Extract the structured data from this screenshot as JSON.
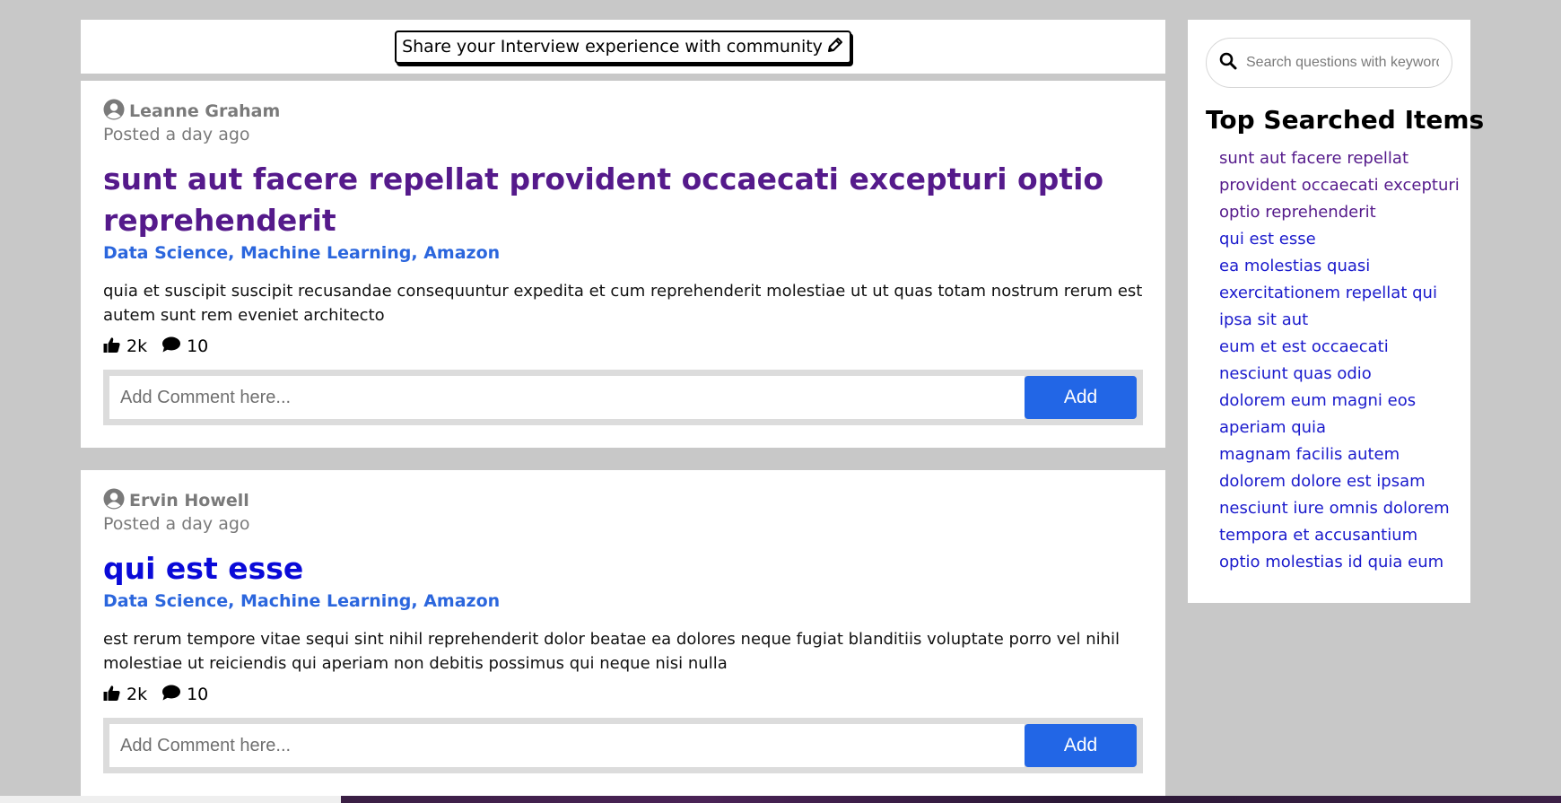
{
  "share": {
    "label": "Share your Interview experience with community",
    "icon": "pencil-icon"
  },
  "posts": [
    {
      "author": "Leanne Graham",
      "posted": "Posted a day ago",
      "title": "sunt aut facere repellat provident occaecati excepturi optio reprehenderit",
      "title_visited": true,
      "tags": "Data Science, Machine Learning, Amazon",
      "body": "quia et suscipit suscipit recusandae consequuntur expedita et cum reprehenderit molestiae ut ut quas totam nostrum rerum est autem sunt rem eveniet architecto",
      "likes": "2k",
      "comments": "10",
      "comment_placeholder": "Add Comment here...",
      "add_label": "Add"
    },
    {
      "author": "Ervin Howell",
      "posted": "Posted a day ago",
      "title": "qui est esse",
      "title_visited": false,
      "tags": "Data Science, Machine Learning, Amazon",
      "body": "est rerum tempore vitae sequi sint nihil reprehenderit dolor beatae ea dolores neque fugiat blanditiis voluptate porro vel nihil molestiae ut reiciendis qui aperiam non debitis possimus qui neque nisi nulla",
      "likes": "2k",
      "comments": "10",
      "comment_placeholder": "Add Comment here...",
      "add_label": "Add"
    }
  ],
  "sidebar": {
    "search_placeholder": "Search questions with keywords",
    "top_title": "Top Searched Items",
    "items": [
      {
        "label": "sunt aut facere repellat",
        "visited": true
      },
      {
        "label": "provident occaecati excepturi",
        "visited": true
      },
      {
        "label": "optio reprehenderit",
        "visited": true
      },
      {
        "label": "qui est esse",
        "visited": false
      },
      {
        "label": "ea molestias quasi",
        "visited": false
      },
      {
        "label": "exercitationem repellat qui",
        "visited": false
      },
      {
        "label": "ipsa sit aut",
        "visited": false
      },
      {
        "label": "eum et est occaecati",
        "visited": false
      },
      {
        "label": "nesciunt quas odio",
        "visited": false
      },
      {
        "label": "dolorem eum magni eos",
        "visited": false
      },
      {
        "label": "aperiam quia",
        "visited": false
      },
      {
        "label": "magnam facilis autem",
        "visited": false
      },
      {
        "label": "dolorem dolore est ipsam",
        "visited": false
      },
      {
        "label": "nesciunt iure omnis dolorem",
        "visited": false
      },
      {
        "label": "tempora et accusantium",
        "visited": false
      },
      {
        "label": "optio molestias id quia eum",
        "visited": false
      }
    ]
  },
  "colors": {
    "background": "#c8c8c8",
    "visited_link": "#551a8b",
    "unvisited_link": "#0a0ad8",
    "tag_blue": "#2b66dd",
    "button_blue": "#2266e6"
  }
}
